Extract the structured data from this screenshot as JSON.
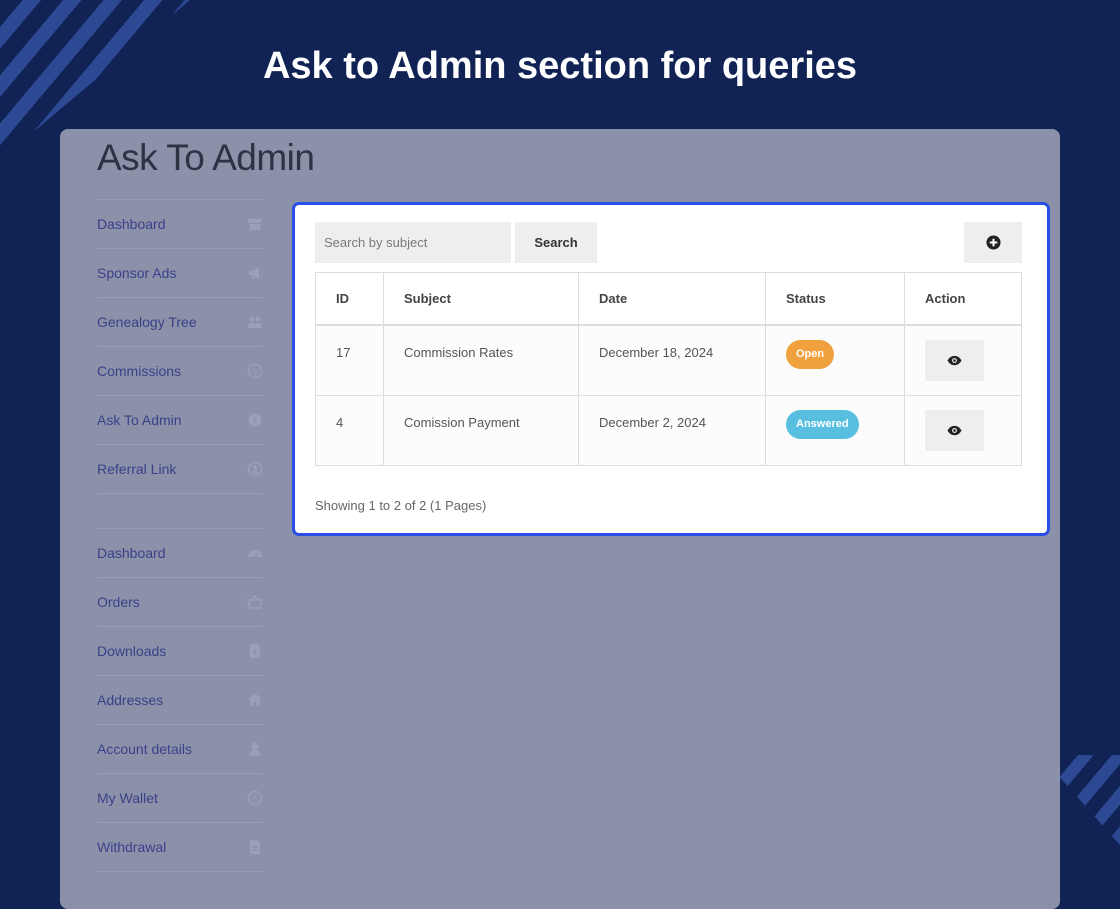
{
  "headline": "Ask to Admin section for queries",
  "page_title": "Ask To Admin",
  "sidebar": {
    "top_items": [
      {
        "label": "Dashboard",
        "icon": "store-icon"
      },
      {
        "label": "Sponsor Ads",
        "icon": "megaphone-icon"
      },
      {
        "label": "Genealogy Tree",
        "icon": "users-icon"
      },
      {
        "label": "Commissions",
        "icon": "dollar-circle-icon"
      },
      {
        "label": "Ask To Admin",
        "icon": "question-circle-icon"
      },
      {
        "label": "Referral Link",
        "icon": "user-circle-icon"
      }
    ],
    "bottom_items": [
      {
        "label": "Dashboard",
        "icon": "gauge-icon"
      },
      {
        "label": "Orders",
        "icon": "basket-icon"
      },
      {
        "label": "Downloads",
        "icon": "file-download-icon"
      },
      {
        "label": "Addresses",
        "icon": "home-icon"
      },
      {
        "label": "Account details",
        "icon": "user-icon"
      },
      {
        "label": "My Wallet",
        "icon": "dollar-circle-icon"
      },
      {
        "label": "Withdrawal",
        "icon": "file-icon"
      }
    ]
  },
  "search": {
    "placeholder": "Search by subject",
    "button_label": "Search"
  },
  "table": {
    "headers": {
      "id": "ID",
      "subject": "Subject",
      "date": "Date",
      "status": "Status",
      "action": "Action"
    },
    "rows": [
      {
        "id": "17",
        "subject": "Commission Rates",
        "date": "December 18, 2024",
        "status": "Open"
      },
      {
        "id": "4",
        "subject": "Comission Payment",
        "date": "December 2, 2024",
        "status": "Answered"
      }
    ]
  },
  "pagination_info": "Showing 1 to 2 of 2 (1 Pages)",
  "colors": {
    "background": "#112255",
    "panel": "#8a91a8",
    "card_border": "#2a4ee8",
    "badge_open": "#f0a03c",
    "badge_answered": "#58bfe0",
    "nav_text": "#3d3f8a"
  }
}
